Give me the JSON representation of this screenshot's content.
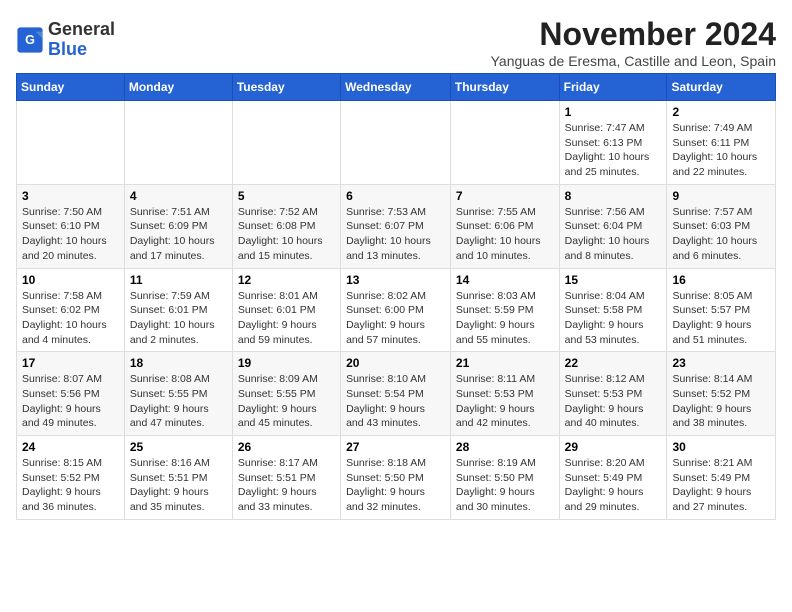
{
  "header": {
    "logo_line1": "General",
    "logo_line2": "Blue",
    "month_title": "November 2024",
    "subtitle": "Yanguas de Eresma, Castille and Leon, Spain"
  },
  "weekdays": [
    "Sunday",
    "Monday",
    "Tuesday",
    "Wednesday",
    "Thursday",
    "Friday",
    "Saturday"
  ],
  "weeks": [
    [
      {
        "day": "",
        "info": ""
      },
      {
        "day": "",
        "info": ""
      },
      {
        "day": "",
        "info": ""
      },
      {
        "day": "",
        "info": ""
      },
      {
        "day": "",
        "info": ""
      },
      {
        "day": "1",
        "info": "Sunrise: 7:47 AM\nSunset: 6:13 PM\nDaylight: 10 hours and 25 minutes."
      },
      {
        "day": "2",
        "info": "Sunrise: 7:49 AM\nSunset: 6:11 PM\nDaylight: 10 hours and 22 minutes."
      }
    ],
    [
      {
        "day": "3",
        "info": "Sunrise: 7:50 AM\nSunset: 6:10 PM\nDaylight: 10 hours and 20 minutes."
      },
      {
        "day": "4",
        "info": "Sunrise: 7:51 AM\nSunset: 6:09 PM\nDaylight: 10 hours and 17 minutes."
      },
      {
        "day": "5",
        "info": "Sunrise: 7:52 AM\nSunset: 6:08 PM\nDaylight: 10 hours and 15 minutes."
      },
      {
        "day": "6",
        "info": "Sunrise: 7:53 AM\nSunset: 6:07 PM\nDaylight: 10 hours and 13 minutes."
      },
      {
        "day": "7",
        "info": "Sunrise: 7:55 AM\nSunset: 6:06 PM\nDaylight: 10 hours and 10 minutes."
      },
      {
        "day": "8",
        "info": "Sunrise: 7:56 AM\nSunset: 6:04 PM\nDaylight: 10 hours and 8 minutes."
      },
      {
        "day": "9",
        "info": "Sunrise: 7:57 AM\nSunset: 6:03 PM\nDaylight: 10 hours and 6 minutes."
      }
    ],
    [
      {
        "day": "10",
        "info": "Sunrise: 7:58 AM\nSunset: 6:02 PM\nDaylight: 10 hours and 4 minutes."
      },
      {
        "day": "11",
        "info": "Sunrise: 7:59 AM\nSunset: 6:01 PM\nDaylight: 10 hours and 2 minutes."
      },
      {
        "day": "12",
        "info": "Sunrise: 8:01 AM\nSunset: 6:01 PM\nDaylight: 9 hours and 59 minutes."
      },
      {
        "day": "13",
        "info": "Sunrise: 8:02 AM\nSunset: 6:00 PM\nDaylight: 9 hours and 57 minutes."
      },
      {
        "day": "14",
        "info": "Sunrise: 8:03 AM\nSunset: 5:59 PM\nDaylight: 9 hours and 55 minutes."
      },
      {
        "day": "15",
        "info": "Sunrise: 8:04 AM\nSunset: 5:58 PM\nDaylight: 9 hours and 53 minutes."
      },
      {
        "day": "16",
        "info": "Sunrise: 8:05 AM\nSunset: 5:57 PM\nDaylight: 9 hours and 51 minutes."
      }
    ],
    [
      {
        "day": "17",
        "info": "Sunrise: 8:07 AM\nSunset: 5:56 PM\nDaylight: 9 hours and 49 minutes."
      },
      {
        "day": "18",
        "info": "Sunrise: 8:08 AM\nSunset: 5:55 PM\nDaylight: 9 hours and 47 minutes."
      },
      {
        "day": "19",
        "info": "Sunrise: 8:09 AM\nSunset: 5:55 PM\nDaylight: 9 hours and 45 minutes."
      },
      {
        "day": "20",
        "info": "Sunrise: 8:10 AM\nSunset: 5:54 PM\nDaylight: 9 hours and 43 minutes."
      },
      {
        "day": "21",
        "info": "Sunrise: 8:11 AM\nSunset: 5:53 PM\nDaylight: 9 hours and 42 minutes."
      },
      {
        "day": "22",
        "info": "Sunrise: 8:12 AM\nSunset: 5:53 PM\nDaylight: 9 hours and 40 minutes."
      },
      {
        "day": "23",
        "info": "Sunrise: 8:14 AM\nSunset: 5:52 PM\nDaylight: 9 hours and 38 minutes."
      }
    ],
    [
      {
        "day": "24",
        "info": "Sunrise: 8:15 AM\nSunset: 5:52 PM\nDaylight: 9 hours and 36 minutes."
      },
      {
        "day": "25",
        "info": "Sunrise: 8:16 AM\nSunset: 5:51 PM\nDaylight: 9 hours and 35 minutes."
      },
      {
        "day": "26",
        "info": "Sunrise: 8:17 AM\nSunset: 5:51 PM\nDaylight: 9 hours and 33 minutes."
      },
      {
        "day": "27",
        "info": "Sunrise: 8:18 AM\nSunset: 5:50 PM\nDaylight: 9 hours and 32 minutes."
      },
      {
        "day": "28",
        "info": "Sunrise: 8:19 AM\nSunset: 5:50 PM\nDaylight: 9 hours and 30 minutes."
      },
      {
        "day": "29",
        "info": "Sunrise: 8:20 AM\nSunset: 5:49 PM\nDaylight: 9 hours and 29 minutes."
      },
      {
        "day": "30",
        "info": "Sunrise: 8:21 AM\nSunset: 5:49 PM\nDaylight: 9 hours and 27 minutes."
      }
    ]
  ]
}
